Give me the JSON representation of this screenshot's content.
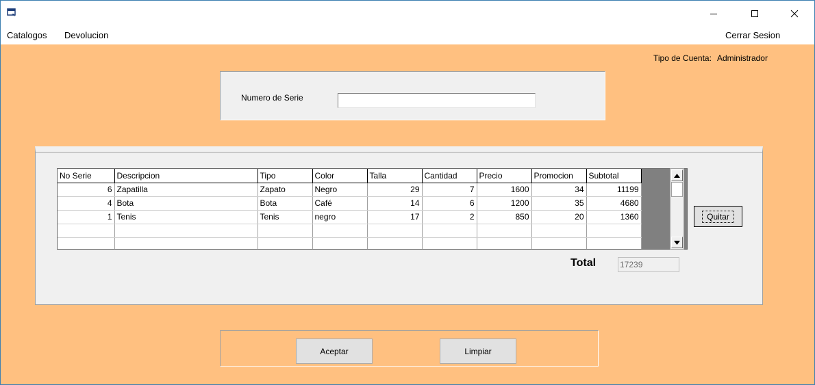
{
  "window": {
    "icon": "app-window-icon",
    "controls": {
      "minimize": "minimize-icon",
      "maximize": "maximize-icon",
      "close": "close-icon"
    }
  },
  "menu": {
    "catalogos": "Catalogos",
    "devolucion": "Devolucion",
    "cerrar_sesion": "Cerrar Sesion"
  },
  "account": {
    "label": "Tipo de Cuenta:",
    "value": "Administrador"
  },
  "serie": {
    "label": "Numero de Serie",
    "value": ""
  },
  "grid": {
    "columns": [
      "No Serie",
      "Descripcion",
      "Tipo",
      "Color",
      "Talla",
      "Cantidad",
      "Precio",
      "Promocion",
      "Subtotal"
    ],
    "rows": [
      [
        "6",
        "Zapatilla",
        "Zapato",
        "Negro",
        "29",
        "7",
        "1600",
        "34",
        "11199"
      ],
      [
        "4",
        "Bota",
        "Bota",
        "Café",
        "14",
        "6",
        "1200",
        "35",
        "4680"
      ],
      [
        "1",
        "Tenis",
        "Tenis",
        "negro",
        "17",
        "2",
        "850",
        "20",
        "1360"
      ]
    ]
  },
  "actions": {
    "quitar": "Quitar",
    "aceptar": "Aceptar",
    "limpiar": "Limpiar"
  },
  "total": {
    "label": "Total",
    "value": "17239"
  },
  "colors": {
    "form_background": "#ffc080",
    "panel_background": "#f0f0f0"
  }
}
